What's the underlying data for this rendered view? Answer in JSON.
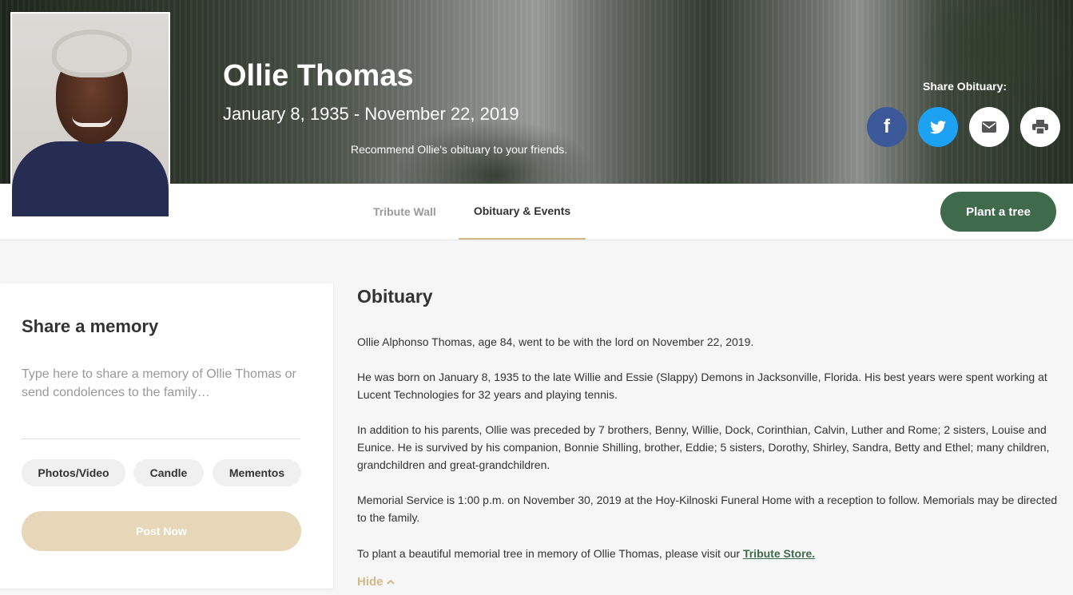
{
  "hero": {
    "name": "Ollie Thomas",
    "dates": "January 8, 1935 - November 22, 2019",
    "recommend": "Recommend Ollie's obituary to your friends.",
    "share_label": "Share Obituary:",
    "share_buttons": [
      {
        "icon": "facebook-icon",
        "color": "#3b5998"
      },
      {
        "icon": "twitter-icon",
        "color": "#1da1f2"
      },
      {
        "icon": "email-icon",
        "color": "#ffffff"
      },
      {
        "icon": "print-icon",
        "color": "#ffffff"
      }
    ]
  },
  "nav": {
    "tabs": [
      {
        "label": "Tribute Wall",
        "active": false
      },
      {
        "label": "Obituary & Events",
        "active": true
      }
    ],
    "plant_button": "Plant a tree"
  },
  "memory": {
    "title": "Share a memory",
    "placeholder": "Type here to share a memory of Ollie Thomas or send condolences to the family…",
    "chips": [
      "Photos/Video",
      "Candle",
      "Mementos"
    ],
    "post_button": "Post Now"
  },
  "obituary": {
    "title": "Obituary",
    "paragraphs": [
      "Ollie Alphonso Thomas, age 84, went to be with the lord on November 22, 2019.",
      "He was born on January 8, 1935 to the late Willie and Essie (Slappy) Demons in Jacksonville, Florida. His best years were spent working at Lucent Technologies for 32 years and playing tennis.",
      "In addition to his parents, Ollie was preceded by 7 brothers, Benny, Willie, Dock, Corinthian, Calvin, Luther and Rome; 2 sisters, Louise and Eunice. He is survived by his companion, Bonnie Shilling, brother, Eddie; 5 sisters, Dorothy, Shirley, Sandra, Betty and Ethel; many children, grandchildren and great-grandchildren.",
      "Memorial Service is 1:00 p.m. on November 30, 2019 at the Hoy-Kilnoski Funeral Home with a reception to follow. Memorials may be directed to the family."
    ],
    "store_text": "To plant a beautiful memorial tree in memory of Ollie Thomas, please visit our",
    "store_link": "Tribute Store.",
    "hide_label": "Hide"
  },
  "colors": {
    "accent_green": "#3f6a4c",
    "accent_gold": "#d2b98a",
    "post_button_bg": "#e5d7b8"
  }
}
